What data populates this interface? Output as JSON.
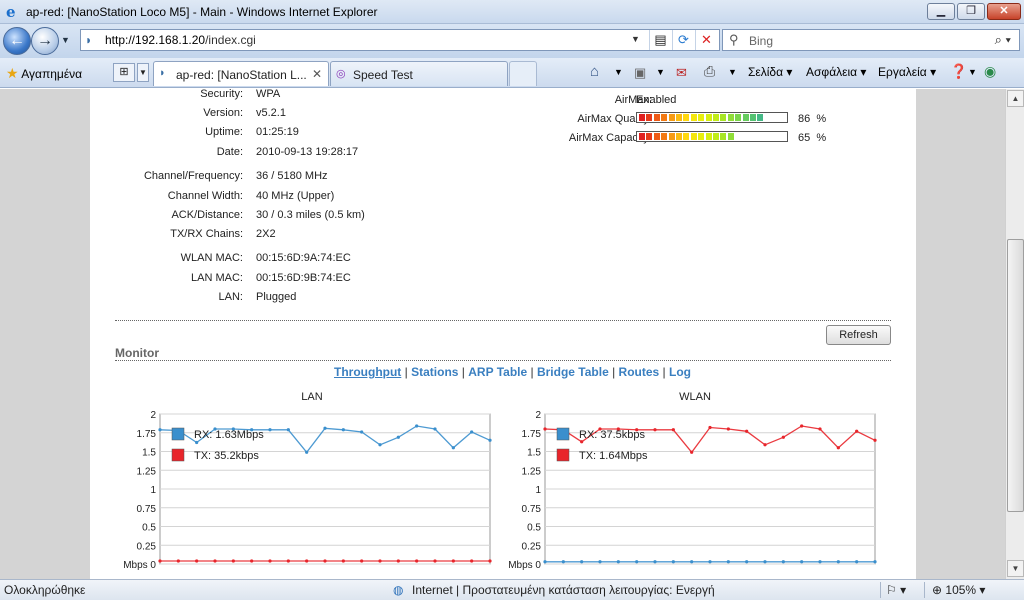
{
  "window": {
    "title": "ap-red: [NanoStation Loco M5] - Main - Windows Internet Explorer",
    "buttons": {
      "minimize": "▁",
      "maximize": "❐",
      "close": "✕"
    }
  },
  "address": {
    "url_host": "http://192.168.1.20",
    "url_path": "/index.cgi",
    "search_placeholder": "Bing"
  },
  "tabbar": {
    "favorites": "Αγαπημένα",
    "tabs": [
      {
        "label": "ap-red: [NanoStation L...",
        "active": true
      },
      {
        "label": "Speed Test",
        "active": false
      }
    ],
    "commands": {
      "page": "Σελίδα",
      "safety": "Ασφάλεια",
      "tools": "Εργαλεία"
    }
  },
  "status_info": {
    "left": [
      {
        "label": "Security:",
        "value": "WPA"
      },
      {
        "label": "Version:",
        "value": "v5.2.1"
      },
      {
        "label": "Uptime:",
        "value": "01:25:19"
      },
      {
        "label": "Date:",
        "value": "2010-09-13 19:28:17"
      },
      {
        "label": "Channel/Frequency:",
        "value": "36  /  5180 MHz"
      },
      {
        "label": "Channel Width:",
        "value": "40 MHz  (Upper)"
      },
      {
        "label": "ACK/Distance:",
        "value": "30 / 0.3 miles (0.5 km)"
      },
      {
        "label": "TX/RX Chains:",
        "value": "2X2"
      },
      {
        "label": "WLAN MAC:",
        "value": "00:15:6D:9A:74:EC"
      },
      {
        "label": "LAN MAC:",
        "value": "00:15:6D:9B:74:EC"
      },
      {
        "label": "LAN:",
        "value": "Plugged"
      }
    ],
    "airmax": {
      "label": "AirMax:",
      "value": "Enabled",
      "quality_label": "AirMax Quality:",
      "quality": 86,
      "capacity_label": "AirMax Capacity:",
      "capacity": 65,
      "pct_unit": "%"
    }
  },
  "refresh_label": "Refresh",
  "monitor": {
    "title": "Monitor",
    "tabs": [
      "Throughput",
      "Stations",
      "ARP Table",
      "Bridge Table",
      "Routes",
      "Log"
    ],
    "active_tab": "Throughput"
  },
  "colors": {
    "rx": "#3a8fcd",
    "tx": "#e8252b",
    "link": "#3a7fc0"
  },
  "chart_data": [
    {
      "type": "line",
      "title": "LAN",
      "yunit": "Mbps",
      "ylim": [
        0,
        2
      ],
      "yticks": [
        0,
        0.25,
        0.5,
        0.75,
        1,
        1.25,
        1.5,
        1.75,
        2
      ],
      "series": [
        {
          "name": "RX: 1.63Mbps",
          "color": "#3a8fcd",
          "values": [
            1.79,
            1.78,
            1.62,
            1.8,
            1.8,
            1.79,
            1.79,
            1.79,
            1.49,
            1.81,
            1.79,
            1.76,
            1.59,
            1.69,
            1.84,
            1.8,
            1.55,
            1.76,
            1.65
          ]
        },
        {
          "name": "TX: 35.2kbps",
          "color": "#e8252b",
          "values": [
            0.04,
            0.04,
            0.04,
            0.04,
            0.04,
            0.04,
            0.04,
            0.04,
            0.04,
            0.04,
            0.04,
            0.04,
            0.04,
            0.04,
            0.04,
            0.04,
            0.04,
            0.04,
            0.04
          ]
        }
      ]
    },
    {
      "type": "line",
      "title": "WLAN",
      "yunit": "Mbps",
      "ylim": [
        0,
        2
      ],
      "yticks": [
        0,
        0.25,
        0.5,
        0.75,
        1,
        1.25,
        1.5,
        1.75,
        2
      ],
      "series": [
        {
          "name": "RX: 37.5kbps",
          "color": "#3a8fcd",
          "values": [
            0.03,
            0.03,
            0.03,
            0.03,
            0.03,
            0.03,
            0.03,
            0.03,
            0.03,
            0.03,
            0.03,
            0.03,
            0.03,
            0.03,
            0.03,
            0.03,
            0.03,
            0.03,
            0.03
          ]
        },
        {
          "name": "TX: 1.64Mbps",
          "color": "#e8252b",
          "values": [
            1.8,
            1.79,
            1.63,
            1.8,
            1.8,
            1.79,
            1.79,
            1.79,
            1.49,
            1.82,
            1.8,
            1.77,
            1.59,
            1.69,
            1.84,
            1.8,
            1.55,
            1.77,
            1.65
          ]
        }
      ]
    }
  ],
  "statusbar": {
    "left": "Ολοκληρώθηκε",
    "zone": "Internet | Προστατευμένη κατάσταση λειτουργίας: Ενεργή",
    "zoom": "105%"
  }
}
